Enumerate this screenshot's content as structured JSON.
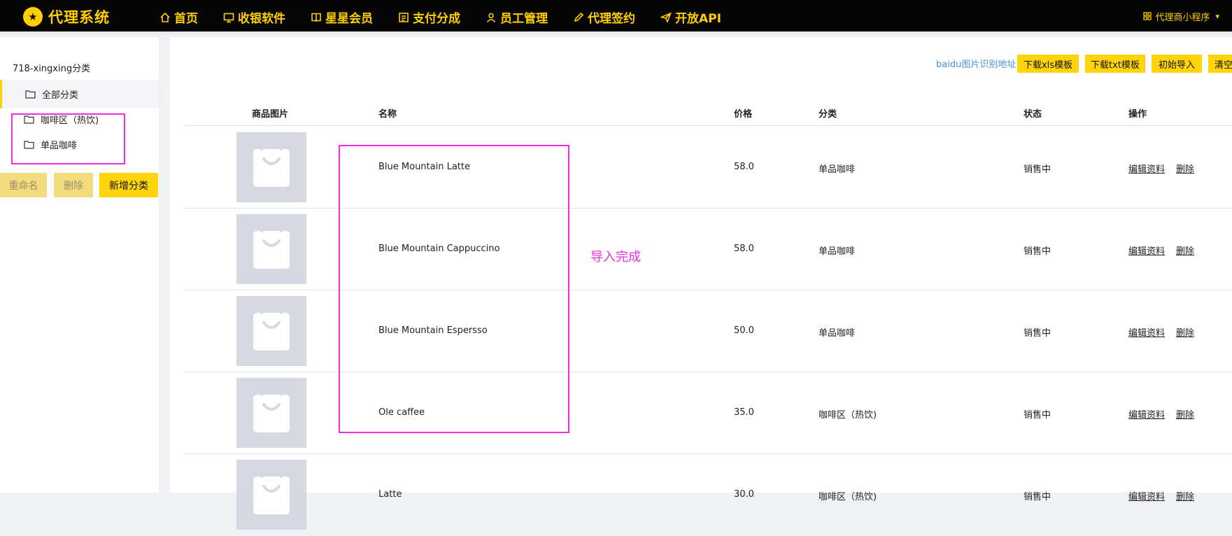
{
  "header": {
    "brand": "代理系统",
    "nav": [
      {
        "label": "首页",
        "icon": "home-icon"
      },
      {
        "label": "收银软件",
        "icon": "monitor-icon"
      },
      {
        "label": "星星会员",
        "icon": "book-icon"
      },
      {
        "label": "支付分成",
        "icon": "receipt-icon"
      },
      {
        "label": "员工管理",
        "icon": "user-icon"
      },
      {
        "label": "代理签约",
        "icon": "pen-icon"
      },
      {
        "label": "开放API",
        "icon": "send-icon"
      }
    ],
    "account": "代理商小程序",
    "colors": {
      "bar": "#050505",
      "accent": "#ffcf00"
    }
  },
  "sidebar": {
    "title": "718-xingxing分类",
    "categories": [
      {
        "label": "全部分类",
        "active": true
      },
      {
        "label": "咖啡区（热饮)",
        "active": false
      },
      {
        "label": "单品咖啡",
        "active": false
      }
    ],
    "buttons": {
      "rename": "重命名",
      "delete": "删除",
      "add": "新增分类"
    }
  },
  "toolbar": {
    "link": "baidu图片识别地址",
    "buttons": [
      "下载xls模板",
      "下载txt模板",
      "初始导入",
      "清空"
    ]
  },
  "table": {
    "headers": [
      "商品图片",
      "名称",
      "价格",
      "分类",
      "状态",
      "操作"
    ],
    "rows": [
      {
        "name": "Blue Mountain Latte",
        "price": "58.0",
        "category": "单品咖啡",
        "status": "销售中",
        "edit": "编辑资料",
        "delete": "删除"
      },
      {
        "name": "Blue Mountain Cappuccino",
        "price": "58.0",
        "category": "单品咖啡",
        "status": "销售中",
        "edit": "编辑资料",
        "delete": "删除"
      },
      {
        "name": "Blue Mountain Espersso",
        "price": "50.0",
        "category": "单品咖啡",
        "status": "销售中",
        "edit": "编辑资料",
        "delete": "删除"
      },
      {
        "name": "Ole caffee",
        "price": "35.0",
        "category": "咖啡区（热饮)",
        "status": "销售中",
        "edit": "编辑资料",
        "delete": "删除"
      },
      {
        "name": "Latte",
        "price": "30.0",
        "category": "咖啡区（热饮)",
        "status": "销售中",
        "edit": "编辑资料",
        "delete": "删除"
      }
    ]
  },
  "annotation": {
    "text": "导入完成",
    "color": "#f02de0"
  }
}
